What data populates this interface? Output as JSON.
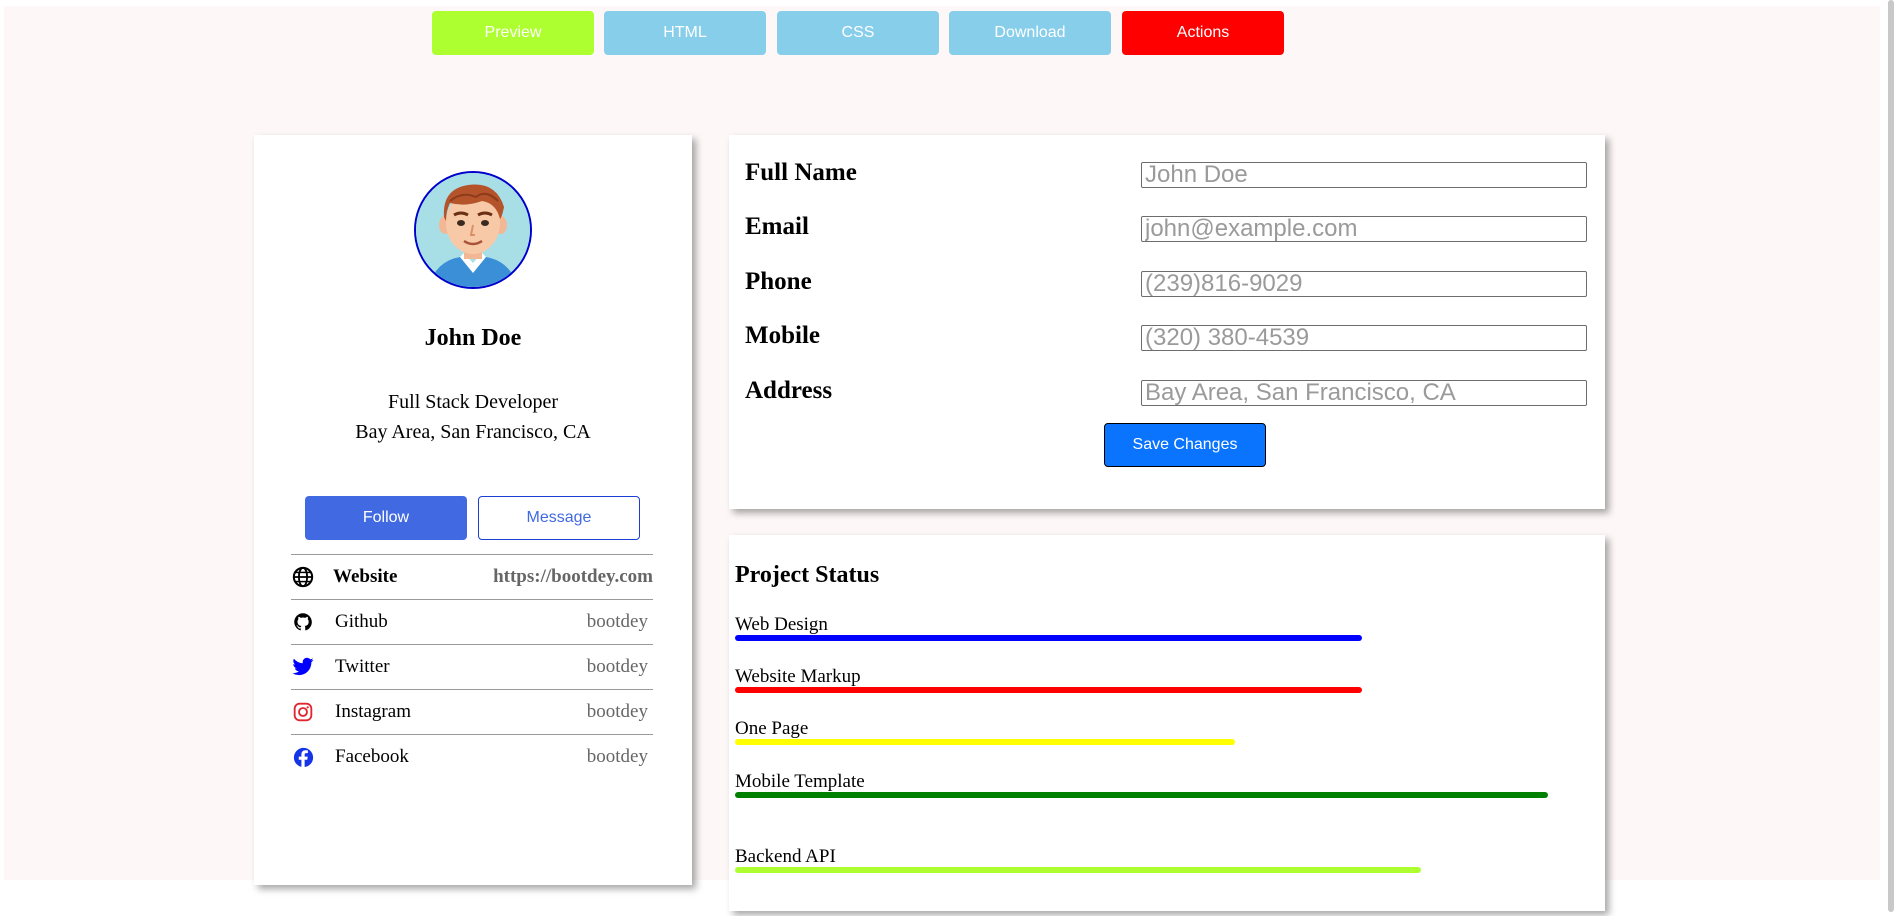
{
  "toolbar": {
    "buttons": [
      {
        "label": "Preview",
        "color": "#adff2f"
      },
      {
        "label": "HTML",
        "color": "#87ceeb"
      },
      {
        "label": "CSS",
        "color": "#87ceeb"
      },
      {
        "label": "Download",
        "color": "#87ceeb"
      },
      {
        "label": "Actions",
        "color": "#ff0000"
      }
    ]
  },
  "profile": {
    "name": "John Doe",
    "role": "Full Stack Developer",
    "location": "Bay Area, San Francisco, CA",
    "follow_label": "Follow",
    "message_label": "Message",
    "links": [
      {
        "icon": "globe-icon",
        "label": "Website",
        "value": "https://bootdey.com"
      },
      {
        "icon": "github-icon",
        "label": "Github",
        "value": "bootdey"
      },
      {
        "icon": "twitter-icon",
        "label": "Twitter",
        "value": "bootdey"
      },
      {
        "icon": "instagram-icon",
        "label": "Instagram",
        "value": "bootdey"
      },
      {
        "icon": "facebook-icon",
        "label": "Facebook",
        "value": "bootdey"
      }
    ]
  },
  "form": {
    "fields": [
      {
        "label": "Full Name",
        "placeholder": "John Doe"
      },
      {
        "label": "Email",
        "placeholder": "john@example.com"
      },
      {
        "label": "Phone",
        "placeholder": "(239)816-9029"
      },
      {
        "label": "Mobile",
        "placeholder": "(320) 380-4539"
      },
      {
        "label": "Address",
        "placeholder": "Bay Area, San Francisco, CA"
      }
    ],
    "save_label": "Save Changes"
  },
  "project_status": {
    "title": "Project Status",
    "items": [
      {
        "name": "Web Design",
        "progress": 0.64,
        "color": "#0000ff"
      },
      {
        "name": "Website Markup",
        "progress": 0.64,
        "color": "#ff0000"
      },
      {
        "name": "One Page",
        "progress": 0.51,
        "color": "#ffff00"
      },
      {
        "name": "Mobile Template",
        "progress": 0.83,
        "color": "#008000"
      },
      {
        "name": "Backend API",
        "progress": 0.7,
        "color": "#adff2f"
      }
    ]
  }
}
